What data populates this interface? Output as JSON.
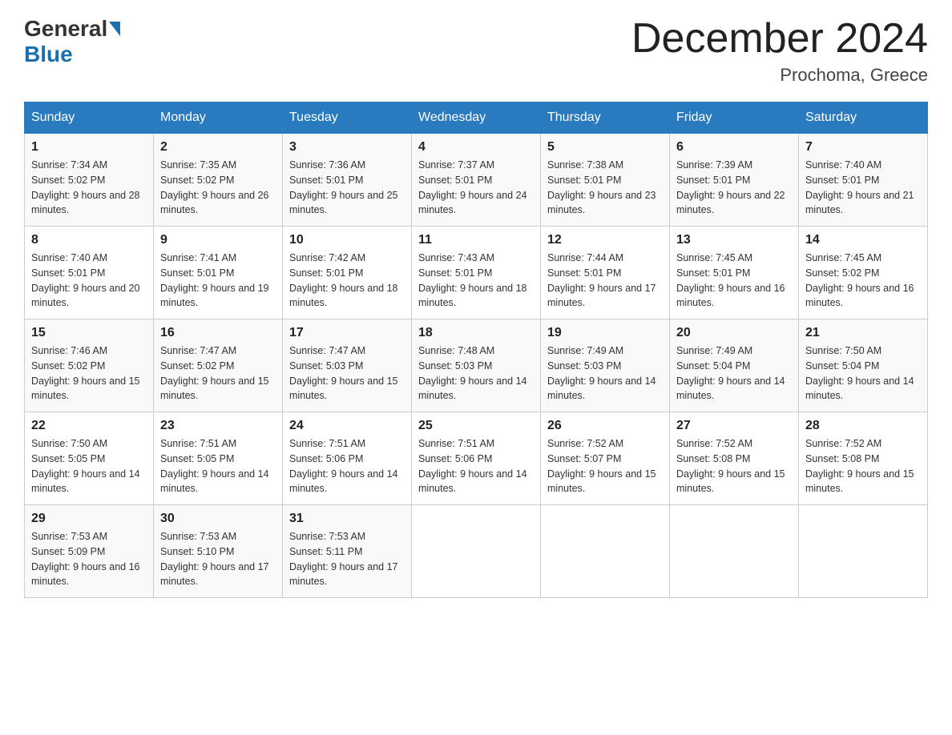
{
  "header": {
    "logo_general": "General",
    "logo_blue": "Blue",
    "month_title": "December 2024",
    "location": "Prochoma, Greece"
  },
  "weekdays": [
    "Sunday",
    "Monday",
    "Tuesday",
    "Wednesday",
    "Thursday",
    "Friday",
    "Saturday"
  ],
  "weeks": [
    [
      {
        "day": "1",
        "sunrise": "Sunrise: 7:34 AM",
        "sunset": "Sunset: 5:02 PM",
        "daylight": "Daylight: 9 hours and 28 minutes."
      },
      {
        "day": "2",
        "sunrise": "Sunrise: 7:35 AM",
        "sunset": "Sunset: 5:02 PM",
        "daylight": "Daylight: 9 hours and 26 minutes."
      },
      {
        "day": "3",
        "sunrise": "Sunrise: 7:36 AM",
        "sunset": "Sunset: 5:01 PM",
        "daylight": "Daylight: 9 hours and 25 minutes."
      },
      {
        "day": "4",
        "sunrise": "Sunrise: 7:37 AM",
        "sunset": "Sunset: 5:01 PM",
        "daylight": "Daylight: 9 hours and 24 minutes."
      },
      {
        "day": "5",
        "sunrise": "Sunrise: 7:38 AM",
        "sunset": "Sunset: 5:01 PM",
        "daylight": "Daylight: 9 hours and 23 minutes."
      },
      {
        "day": "6",
        "sunrise": "Sunrise: 7:39 AM",
        "sunset": "Sunset: 5:01 PM",
        "daylight": "Daylight: 9 hours and 22 minutes."
      },
      {
        "day": "7",
        "sunrise": "Sunrise: 7:40 AM",
        "sunset": "Sunset: 5:01 PM",
        "daylight": "Daylight: 9 hours and 21 minutes."
      }
    ],
    [
      {
        "day": "8",
        "sunrise": "Sunrise: 7:40 AM",
        "sunset": "Sunset: 5:01 PM",
        "daylight": "Daylight: 9 hours and 20 minutes."
      },
      {
        "day": "9",
        "sunrise": "Sunrise: 7:41 AM",
        "sunset": "Sunset: 5:01 PM",
        "daylight": "Daylight: 9 hours and 19 minutes."
      },
      {
        "day": "10",
        "sunrise": "Sunrise: 7:42 AM",
        "sunset": "Sunset: 5:01 PM",
        "daylight": "Daylight: 9 hours and 18 minutes."
      },
      {
        "day": "11",
        "sunrise": "Sunrise: 7:43 AM",
        "sunset": "Sunset: 5:01 PM",
        "daylight": "Daylight: 9 hours and 18 minutes."
      },
      {
        "day": "12",
        "sunrise": "Sunrise: 7:44 AM",
        "sunset": "Sunset: 5:01 PM",
        "daylight": "Daylight: 9 hours and 17 minutes."
      },
      {
        "day": "13",
        "sunrise": "Sunrise: 7:45 AM",
        "sunset": "Sunset: 5:01 PM",
        "daylight": "Daylight: 9 hours and 16 minutes."
      },
      {
        "day": "14",
        "sunrise": "Sunrise: 7:45 AM",
        "sunset": "Sunset: 5:02 PM",
        "daylight": "Daylight: 9 hours and 16 minutes."
      }
    ],
    [
      {
        "day": "15",
        "sunrise": "Sunrise: 7:46 AM",
        "sunset": "Sunset: 5:02 PM",
        "daylight": "Daylight: 9 hours and 15 minutes."
      },
      {
        "day": "16",
        "sunrise": "Sunrise: 7:47 AM",
        "sunset": "Sunset: 5:02 PM",
        "daylight": "Daylight: 9 hours and 15 minutes."
      },
      {
        "day": "17",
        "sunrise": "Sunrise: 7:47 AM",
        "sunset": "Sunset: 5:03 PM",
        "daylight": "Daylight: 9 hours and 15 minutes."
      },
      {
        "day": "18",
        "sunrise": "Sunrise: 7:48 AM",
        "sunset": "Sunset: 5:03 PM",
        "daylight": "Daylight: 9 hours and 14 minutes."
      },
      {
        "day": "19",
        "sunrise": "Sunrise: 7:49 AM",
        "sunset": "Sunset: 5:03 PM",
        "daylight": "Daylight: 9 hours and 14 minutes."
      },
      {
        "day": "20",
        "sunrise": "Sunrise: 7:49 AM",
        "sunset": "Sunset: 5:04 PM",
        "daylight": "Daylight: 9 hours and 14 minutes."
      },
      {
        "day": "21",
        "sunrise": "Sunrise: 7:50 AM",
        "sunset": "Sunset: 5:04 PM",
        "daylight": "Daylight: 9 hours and 14 minutes."
      }
    ],
    [
      {
        "day": "22",
        "sunrise": "Sunrise: 7:50 AM",
        "sunset": "Sunset: 5:05 PM",
        "daylight": "Daylight: 9 hours and 14 minutes."
      },
      {
        "day": "23",
        "sunrise": "Sunrise: 7:51 AM",
        "sunset": "Sunset: 5:05 PM",
        "daylight": "Daylight: 9 hours and 14 minutes."
      },
      {
        "day": "24",
        "sunrise": "Sunrise: 7:51 AM",
        "sunset": "Sunset: 5:06 PM",
        "daylight": "Daylight: 9 hours and 14 minutes."
      },
      {
        "day": "25",
        "sunrise": "Sunrise: 7:51 AM",
        "sunset": "Sunset: 5:06 PM",
        "daylight": "Daylight: 9 hours and 14 minutes."
      },
      {
        "day": "26",
        "sunrise": "Sunrise: 7:52 AM",
        "sunset": "Sunset: 5:07 PM",
        "daylight": "Daylight: 9 hours and 15 minutes."
      },
      {
        "day": "27",
        "sunrise": "Sunrise: 7:52 AM",
        "sunset": "Sunset: 5:08 PM",
        "daylight": "Daylight: 9 hours and 15 minutes."
      },
      {
        "day": "28",
        "sunrise": "Sunrise: 7:52 AM",
        "sunset": "Sunset: 5:08 PM",
        "daylight": "Daylight: 9 hours and 15 minutes."
      }
    ],
    [
      {
        "day": "29",
        "sunrise": "Sunrise: 7:53 AM",
        "sunset": "Sunset: 5:09 PM",
        "daylight": "Daylight: 9 hours and 16 minutes."
      },
      {
        "day": "30",
        "sunrise": "Sunrise: 7:53 AM",
        "sunset": "Sunset: 5:10 PM",
        "daylight": "Daylight: 9 hours and 17 minutes."
      },
      {
        "day": "31",
        "sunrise": "Sunrise: 7:53 AM",
        "sunset": "Sunset: 5:11 PM",
        "daylight": "Daylight: 9 hours and 17 minutes."
      },
      null,
      null,
      null,
      null
    ]
  ]
}
